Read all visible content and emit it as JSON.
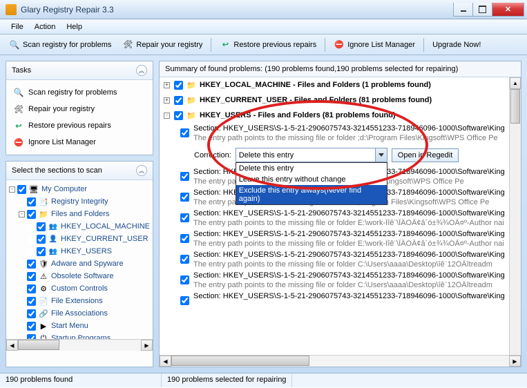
{
  "title": "Glary Registry Repair 3.3",
  "menu": {
    "file": "File",
    "action": "Action",
    "help": "Help"
  },
  "toolbar": {
    "scan": "Scan registry for problems",
    "repair": "Repair your registry",
    "restore": "Restore previous repairs",
    "ignore": "Ignore List Manager",
    "upgrade": "Upgrade Now!"
  },
  "tasks": {
    "title": "Tasks",
    "scan": "Scan registry for problems",
    "repair": "Repair your registry",
    "restore": "Restore previous repairs",
    "ignore": "Ignore List Manager"
  },
  "sections": {
    "title": "Select the sections to scan",
    "nodes": [
      {
        "depth": 1,
        "exp": "-",
        "label": "My Computer",
        "icon": "computer"
      },
      {
        "depth": 2,
        "exp": "",
        "label": "Registry Integrity",
        "icon": "reg"
      },
      {
        "depth": 2,
        "exp": "-",
        "label": "Files and Folders",
        "icon": "folder"
      },
      {
        "depth": 3,
        "exp": "",
        "label": "HKEY_LOCAL_MACHINE",
        "icon": "people"
      },
      {
        "depth": 3,
        "exp": "",
        "label": "HKEY_CURRENT_USER",
        "icon": "person"
      },
      {
        "depth": 3,
        "exp": "",
        "label": "HKEY_USERS",
        "icon": "people"
      },
      {
        "depth": 2,
        "exp": "",
        "label": "Adware and Spyware",
        "icon": "spy"
      },
      {
        "depth": 2,
        "exp": "",
        "label": "Obsolete Software",
        "icon": "obsolete"
      },
      {
        "depth": 2,
        "exp": "",
        "label": "Custom Controls",
        "icon": "custom"
      },
      {
        "depth": 2,
        "exp": "",
        "label": "File Extensions",
        "icon": "ext"
      },
      {
        "depth": 2,
        "exp": "",
        "label": "File Associations",
        "icon": "assoc"
      },
      {
        "depth": 2,
        "exp": "",
        "label": "Start Menu",
        "icon": "start"
      },
      {
        "depth": 2,
        "exp": "",
        "label": "Startup Programs",
        "icon": "startup"
      }
    ]
  },
  "summary": "Summary of found problems: (190 problems found,190 problems selected for repairing)",
  "groups": [
    {
      "exp": "+",
      "label": "HKEY_LOCAL_MACHINE - Files and Folders  (1 problems found)"
    },
    {
      "exp": "+",
      "label": "HKEY_CURRENT_USER - Files and Folders  (81 problems found)"
    },
    {
      "exp": "-",
      "label": "HKEY_USERS - Files and Folders  (81 problems found)"
    }
  ],
  "correction": {
    "label": "Correction:",
    "selected": "Delete this entry",
    "options": [
      "Delete this entry",
      "Leave this entry without change",
      "Exclude this entry always(Never find again)"
    ],
    "open": "Open in Regedit"
  },
  "items": [
    {
      "sec": "Section: HKEY_USERS\\S-1-5-21-2906075743-3214551233-718946096-1000\\Software\\King",
      "desc": "The entry path points to the missing file or folder ;d:\\Program Files\\Kingsoft\\WPS Office Pe"
    },
    {
      "sec": "Section: HKEY_USERS\\S-1-5-21-2906075743-3214551233-718946096-1000\\Software\\King",
      "desc": "The entry path points to the missing file or folder in Files\\Kingsoft\\WPS Office Pe"
    },
    {
      "sec": "Section: HKEY_USERS\\S-1-5-21-2906075743-3214551233-718946096-1000\\Software\\King",
      "desc": "The entry path points to the missing file or folder ;Program Files\\Kingsoft\\WPS Office Pe"
    },
    {
      "sec": "Section: HKEY_USERS\\S-1-5-21-2906075743-3214551233-718946096-1000\\Software\\King",
      "desc": "The entry path points to the missing file or folder E:\\work-Ïîê¨\\ÎÂÒÂ¢â´ó±¾¾ÓÂ¤º-Author nai"
    },
    {
      "sec": "Section: HKEY_USERS\\S-1-5-21-2906075743-3214551233-718946096-1000\\Software\\King",
      "desc": "The entry path points to the missing file or folder E:\\work-Ïîê¨\\ÎÂÒÂ¢â´ó±¾¾ÓÂ¤º-Author nai"
    },
    {
      "sec": "Section: HKEY_USERS\\S-1-5-21-2906075743-3214551233-718946096-1000\\Software\\King",
      "desc": "The entry path points to the missing file or folder C:\\Users\\aaaa\\Desktop\\îê¨12ÒÂîtreadm"
    },
    {
      "sec": "Section: HKEY_USERS\\S-1-5-21-2906075743-3214551233-718946096-1000\\Software\\King",
      "desc": "The entry path points to the missing file or folder C:\\Users\\aaaa\\Desktop\\îê¨12ÒÂîtreadm"
    },
    {
      "sec": "Section: HKEY_USERS\\S-1-5-21-2906075743-3214551233-718946096-1000\\Software\\King",
      "desc": ""
    }
  ],
  "status": {
    "found": "190 problems found",
    "selected": "190 problems selected for repairing"
  }
}
